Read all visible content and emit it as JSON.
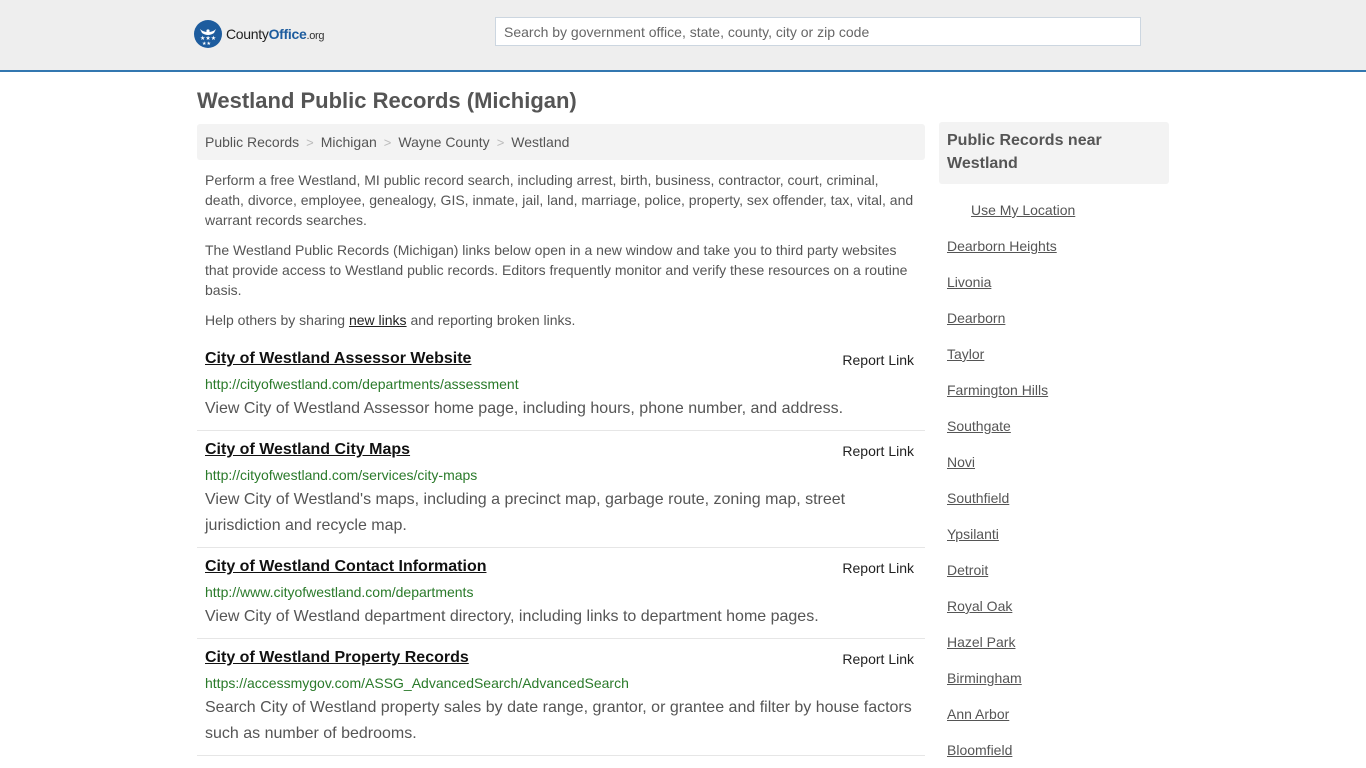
{
  "header": {
    "logo": {
      "brand_county": "County",
      "brand_office": "Office",
      "brand_tld": ".org",
      "icon": "eagle-stars-badge-icon"
    },
    "search": {
      "placeholder": "Search by government office, state, county, city or zip code",
      "value": ""
    }
  },
  "colors": {
    "accent": "#3377b0",
    "brand": "#1d5c9e",
    "url_green": "#2a7a2a",
    "panel_bg": "#f3f3f3",
    "header_bg": "#eeeeee"
  },
  "main": {
    "title": "Westland Public Records (Michigan)",
    "breadcrumb": [
      {
        "label": "Public Records"
      },
      {
        "label": "Michigan"
      },
      {
        "label": "Wayne County"
      },
      {
        "label": "Westland"
      }
    ],
    "breadcrumb_separator": ">",
    "intro": [
      "Perform a free Westland, MI public record search, including arrest, birth, business, contractor, court, criminal, death, divorce, employee, genealogy, GIS, inmate, jail, land, marriage, police, property, sex offender, tax, vital, and warrant records searches.",
      "The Westland Public Records (Michigan) links below open in a new window and take you to third party websites that provide access to Westland public records. Editors frequently monitor and verify these resources on a routine basis."
    ],
    "help": {
      "prefix": "Help others by sharing ",
      "link": "new links",
      "suffix": " and reporting broken links."
    },
    "report_label": "Report Link",
    "records": [
      {
        "title": "City of Westland Assessor Website",
        "url": "http://cityofwestland.com/departments/assessment",
        "description": "View City of Westland Assessor home page, including hours, phone number, and address."
      },
      {
        "title": "City of Westland City Maps",
        "url": "http://cityofwestland.com/services/city-maps",
        "description": "View City of Westland's maps, including a precinct map, garbage route, zoning map, street jurisdiction and recycle map."
      },
      {
        "title": "City of Westland Contact Information",
        "url": "http://www.cityofwestland.com/departments",
        "description": "View City of Westland department directory, including links to department home pages."
      },
      {
        "title": "City of Westland Property Records",
        "url": "https://accessmygov.com/ASSG_AdvancedSearch/AdvancedSearch",
        "description": "Search City of Westland property sales by date range, grantor, or grantee and filter by house factors such as number of bedrooms."
      }
    ]
  },
  "sidebar": {
    "heading": "Public Records near Westland",
    "use_location": "Use My Location",
    "cities": [
      "Dearborn Heights",
      "Livonia",
      "Dearborn",
      "Taylor",
      "Farmington Hills",
      "Southgate",
      "Novi",
      "Southfield",
      "Ypsilanti",
      "Detroit",
      "Royal Oak",
      "Hazel Park",
      "Birmingham",
      "Ann Arbor",
      "Bloomfield"
    ]
  }
}
